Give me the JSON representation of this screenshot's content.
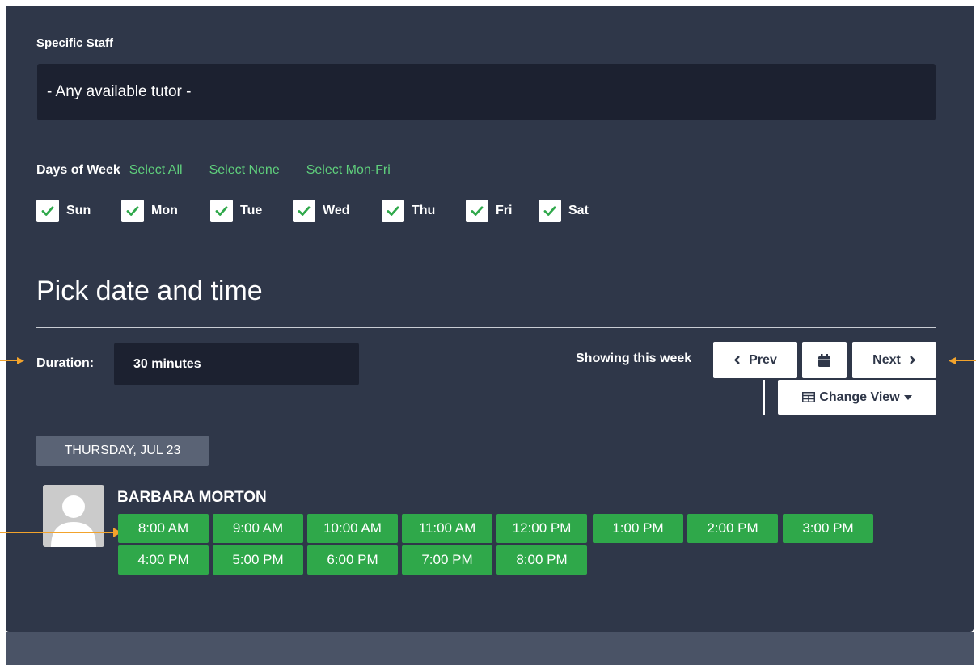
{
  "staff": {
    "label": "Specific Staff",
    "selected": "- Any available tutor -"
  },
  "days": {
    "label": "Days of Week",
    "links": [
      "Select All",
      "Select None",
      "Select Mon-Fri"
    ],
    "items": [
      {
        "label": "Sun",
        "checked": true
      },
      {
        "label": "Mon",
        "checked": true
      },
      {
        "label": "Tue",
        "checked": true
      },
      {
        "label": "Wed",
        "checked": true
      },
      {
        "label": "Thu",
        "checked": true
      },
      {
        "label": "Fri",
        "checked": true
      },
      {
        "label": "Sat",
        "checked": true
      }
    ]
  },
  "picker": {
    "title": "Pick date and time",
    "duration_label": "Duration:",
    "duration_value": "30 minutes",
    "showing": "Showing this week",
    "prev": "Prev",
    "next": "Next",
    "change_view": "Change View"
  },
  "schedule": {
    "date": "THURSDAY, JUL 23",
    "staff_name": "BARBARA MORTON",
    "slots": [
      "8:00 AM",
      "9:00 AM",
      "10:00 AM",
      "11:00 AM",
      "12:00 PM",
      "1:00 PM",
      "2:00 PM",
      "3:00 PM",
      "4:00 PM",
      "5:00 PM",
      "6:00 PM",
      "7:00 PM",
      "8:00 PM"
    ]
  },
  "colors": {
    "panel": "#2f3749",
    "input": "#1c2130",
    "accent_green": "#2fa84a",
    "link_green": "#5fcf7c",
    "annotation": "#f2a32c"
  },
  "icons": [
    "check-icon",
    "chevron-left-icon",
    "calendar-icon",
    "chevron-right-icon",
    "grid-icon",
    "caret-down-icon",
    "user-avatar-icon"
  ]
}
